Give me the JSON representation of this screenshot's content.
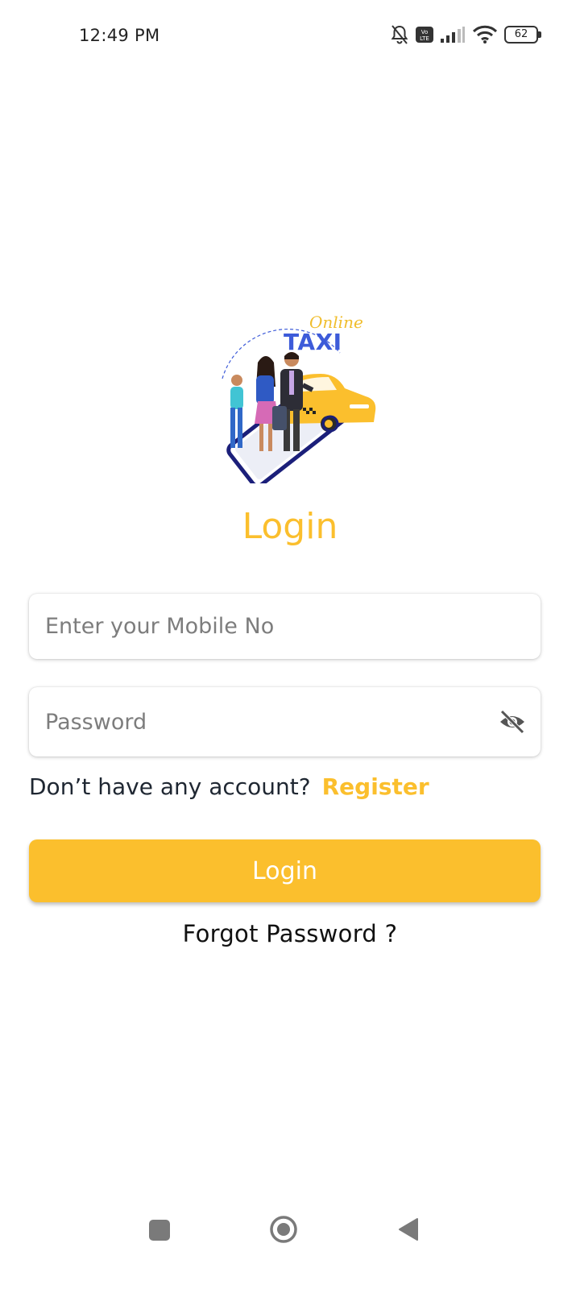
{
  "status_bar": {
    "time": "12:49 PM",
    "network_badge": "Vo LTE",
    "battery_level": "62"
  },
  "logo": {
    "line1": "Online",
    "line2": "TAXI"
  },
  "login_form": {
    "title": "Login",
    "mobile_placeholder": "Enter your Mobile No",
    "mobile_value": "",
    "password_placeholder": "Password",
    "password_value": "",
    "register_prompt": "Don’t have any account?",
    "register_link": "Register",
    "login_button": "Login",
    "forgot_password": "Forgot Password ?"
  },
  "colors": {
    "accent": "#fbbf2d",
    "logo_blue": "#3d5bd9",
    "text_dark": "#1f2732"
  }
}
